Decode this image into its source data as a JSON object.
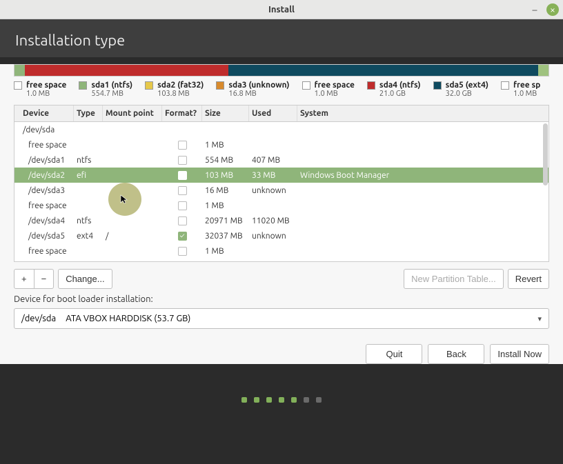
{
  "window": {
    "title": "Install"
  },
  "header": {
    "title": "Installation type"
  },
  "disk_bar": [
    {
      "color": "#8fb57a",
      "width": 2
    },
    {
      "color": "#bf2c2c",
      "width": 38
    },
    {
      "color": "#0f4a5f",
      "width": 58
    },
    {
      "color": "#9fc27f",
      "width": 2
    }
  ],
  "legend": [
    {
      "swatch": "#ffffff",
      "name": "free space",
      "size": "1.0 MB"
    },
    {
      "swatch": "#8fb57a",
      "name": "sda1 (ntfs)",
      "size": "554.7 MB"
    },
    {
      "swatch": "#e6c84a",
      "name": "sda2 (fat32)",
      "size": "103.8 MB"
    },
    {
      "swatch": "#d88a2c",
      "name": "sda3 (unknown)",
      "size": "16.8 MB"
    },
    {
      "swatch": "#ffffff",
      "name": "free space",
      "size": "1.0 MB"
    },
    {
      "swatch": "#bf2c2c",
      "name": "sda4 (ntfs)",
      "size": "21.0 GB"
    },
    {
      "swatch": "#0f4a5f",
      "name": "sda5 (ext4)",
      "size": "32.0 GB"
    },
    {
      "swatch": "#ffffff",
      "name": "free sp",
      "size": "1.0 MB"
    }
  ],
  "columns": {
    "device": "Device",
    "type": "Type",
    "mount": "Mount point",
    "format": "Format?",
    "size": "Size",
    "used": "Used",
    "system": "System"
  },
  "rows": [
    {
      "device": "/dev/sda",
      "type": "",
      "mount": "",
      "format": null,
      "size": "",
      "used": "",
      "system": "",
      "disk_header": true
    },
    {
      "device": "free space",
      "type": "",
      "mount": "",
      "format": false,
      "size": "1 MB",
      "used": "",
      "system": ""
    },
    {
      "device": "/dev/sda1",
      "type": "ntfs",
      "mount": "",
      "format": false,
      "size": "554 MB",
      "used": "407 MB",
      "system": ""
    },
    {
      "device": "/dev/sda2",
      "type": "efi",
      "mount": "",
      "format": false,
      "size": "103 MB",
      "used": "33 MB",
      "system": "Windows Boot Manager",
      "selected": true
    },
    {
      "device": "/dev/sda3",
      "type": "",
      "mount": "",
      "format": false,
      "size": "16 MB",
      "used": "unknown",
      "system": ""
    },
    {
      "device": "free space",
      "type": "",
      "mount": "",
      "format": false,
      "size": "1 MB",
      "used": "",
      "system": ""
    },
    {
      "device": "/dev/sda4",
      "type": "ntfs",
      "mount": "",
      "format": false,
      "size": "20971 MB",
      "used": "11020 MB",
      "system": ""
    },
    {
      "device": "/dev/sda5",
      "type": "ext4",
      "mount": "/",
      "format": true,
      "size": "32037 MB",
      "used": "unknown",
      "system": ""
    },
    {
      "device": "free space",
      "type": "",
      "mount": "",
      "format": false,
      "size": "1 MB",
      "used": "",
      "system": ""
    }
  ],
  "toolbar": {
    "add": "+",
    "remove": "−",
    "change": "Change...",
    "new_table": "New Partition Table...",
    "revert": "Revert"
  },
  "bootloader": {
    "label": "Device for boot loader installation:",
    "device": "/dev/sda",
    "desc": "ATA VBOX HARDDISK (53.7 GB)"
  },
  "footer": {
    "quit": "Quit",
    "back": "Back",
    "install": "Install Now"
  },
  "pager": {
    "total": 7,
    "current": 5
  }
}
